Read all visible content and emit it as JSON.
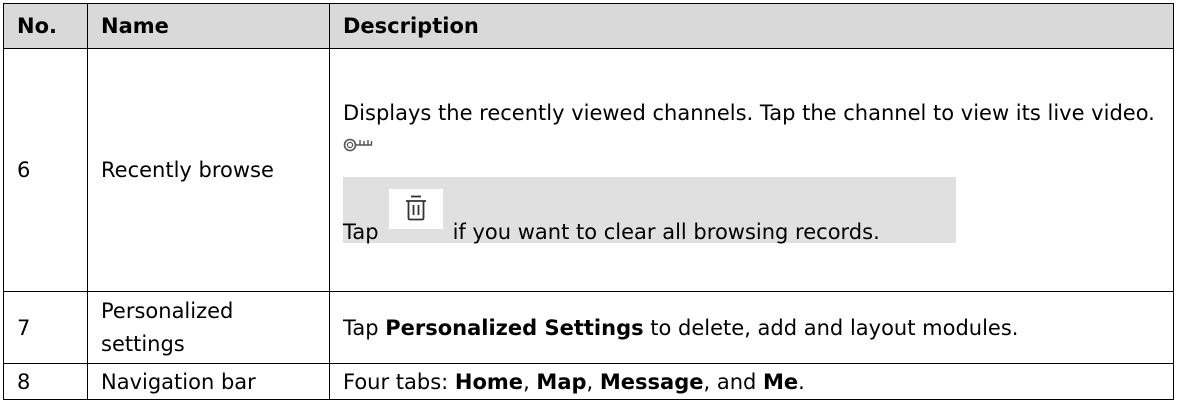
{
  "table": {
    "headers": [
      "No.",
      "Name",
      "Description"
    ],
    "rows": [
      {
        "no": "6",
        "name": "Recently browse",
        "description": "Displays the recently viewed channels. Tap the channel to view its live video.",
        "note": {
          "icon": "key-icon",
          "prefix": "Tap",
          "button_icon": "trash-icon",
          "suffix": "if you want to clear all browsing records."
        }
      },
      {
        "no": "7",
        "name": "Personalized settings",
        "description_parts": {
          "prefix": "Tap ",
          "bold": "Personalized Settings",
          "suffix": " to delete, add and layout modules."
        }
      },
      {
        "no": "8",
        "name": "Navigation bar",
        "description_parts": {
          "prefix": "Four tabs: ",
          "tab1": "Home",
          "sep1": ", ",
          "tab2": "Map",
          "sep2": ", ",
          "tab3": "Message",
          "sep3": ", and ",
          "tab4": "Me",
          "end": "."
        }
      }
    ]
  },
  "colors": {
    "header_bg": "#d9d9d9",
    "note_bg": "#e0e0e0",
    "border": "#000000"
  }
}
